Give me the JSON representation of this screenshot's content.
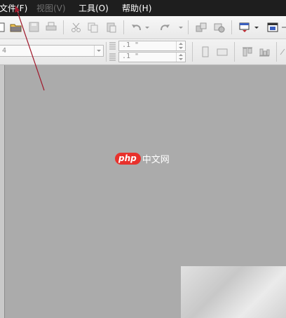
{
  "menubar": {
    "items": [
      {
        "label": "文件(F)",
        "enabled": true
      },
      {
        "label": "视图(V)",
        "enabled": false
      },
      {
        "label": "工具(O)",
        "enabled": true
      },
      {
        "label": "帮助(H)",
        "enabled": true
      }
    ]
  },
  "toolbar": {
    "font_size_value": "4",
    "spacing_before_value": ".1 \"",
    "spacing_after_value": ".1 \""
  },
  "watermark": {
    "logo_text": "php",
    "site_text": "中文网"
  },
  "colors": {
    "menubar_bg": "#1e1e1e",
    "canvas_bg": "#ababab",
    "annotation_arrow": "#a0172a",
    "watermark_red": "#e8312c"
  }
}
